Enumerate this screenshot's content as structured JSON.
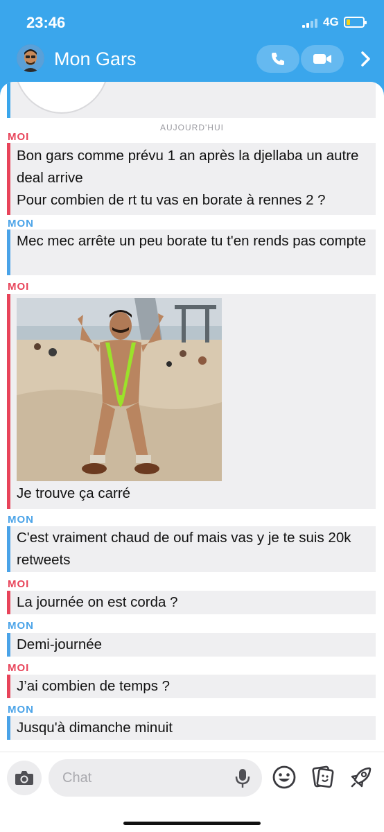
{
  "status": {
    "time": "23:46",
    "network": "4G"
  },
  "header": {
    "title": "Mon Gars"
  },
  "chat": {
    "date_separator": "AUJOURD'HUI",
    "messages": [
      {
        "sender": "MOI",
        "side": "moi",
        "text": "Bon gars comme prévu 1 an après la djellaba un autre deal arrive\nPour combien de rt tu vas en borate à rennes 2 ?"
      },
      {
        "sender": "MON",
        "side": "mon",
        "text": "Mec mec arrête un peu borate tu t'en rends pas compte"
      },
      {
        "sender": "MOI",
        "side": "moi",
        "text": "Je trouve ça carré",
        "has_image": true
      },
      {
        "sender": "MON",
        "side": "mon",
        "text": "C'est vraiment chaud de ouf mais vas y je te suis 20k retweets"
      },
      {
        "sender": "MOI",
        "side": "moi",
        "text": "La journée on est corda ?"
      },
      {
        "sender": "MON",
        "side": "mon",
        "text": "Demi-journée"
      },
      {
        "sender": "MOI",
        "side": "moi",
        "text": "J’ai combien de temps ?"
      },
      {
        "sender": "MON",
        "side": "mon",
        "text": "Jusqu'à dimanche minuit"
      }
    ]
  },
  "footer": {
    "input_placeholder": "Chat",
    "icons": [
      "camera-icon",
      "microphone-icon",
      "smiley-icon",
      "stickers-icon",
      "rocket-icon"
    ]
  },
  "colors": {
    "header_bg": "#3aa6ec",
    "moi": "#e8445a",
    "mon": "#4aa3e8",
    "bubble_bg": "#efeff1"
  }
}
